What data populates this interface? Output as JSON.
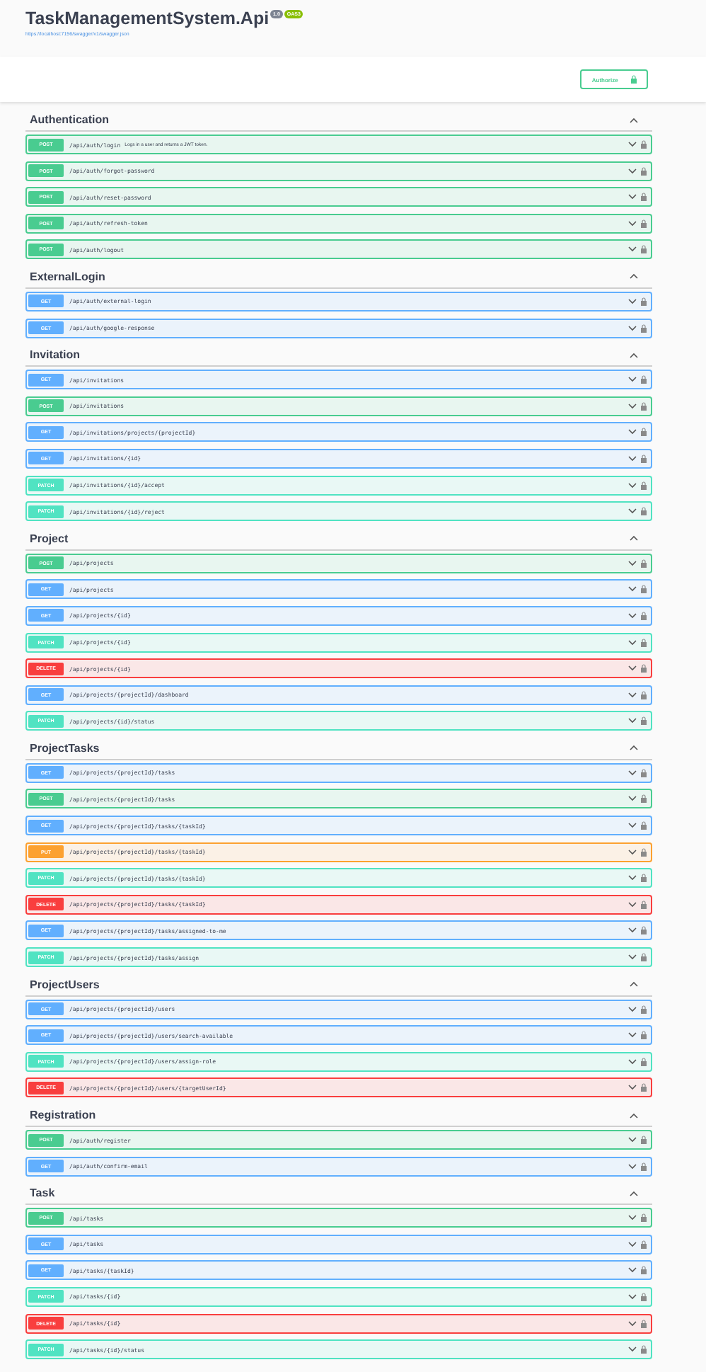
{
  "header": {
    "title": "TaskManagementSystem.Api",
    "version": "1.0",
    "spec": "OAS3",
    "url": "https://localhost:7156/swagger/v1/swagger.json"
  },
  "authorize": {
    "label": "Authorize"
  },
  "sections": [
    {
      "name": "Authentication",
      "expanded": true,
      "operations": [
        {
          "method": "POST",
          "path": "/api/auth/login",
          "summary": "Logs in a user and returns a JWT token."
        },
        {
          "method": "POST",
          "path": "/api/auth/forgot-password"
        },
        {
          "method": "POST",
          "path": "/api/auth/reset-password"
        },
        {
          "method": "POST",
          "path": "/api/auth/refresh-token"
        },
        {
          "method": "POST",
          "path": "/api/auth/logout"
        }
      ]
    },
    {
      "name": "ExternalLogin",
      "expanded": true,
      "operations": [
        {
          "method": "GET",
          "path": "/api/auth/external-login"
        },
        {
          "method": "GET",
          "path": "/api/auth/google-response"
        }
      ]
    },
    {
      "name": "Invitation",
      "expanded": true,
      "operations": [
        {
          "method": "GET",
          "path": "/api/invitations"
        },
        {
          "method": "POST",
          "path": "/api/invitations"
        },
        {
          "method": "GET",
          "path": "/api/invitations/projects/{projectId}"
        },
        {
          "method": "GET",
          "path": "/api/invitations/{id}"
        },
        {
          "method": "PATCH",
          "path": "/api/invitations/{id}/accept"
        },
        {
          "method": "PATCH",
          "path": "/api/invitations/{id}/reject"
        }
      ]
    },
    {
      "name": "Project",
      "expanded": true,
      "operations": [
        {
          "method": "POST",
          "path": "/api/projects"
        },
        {
          "method": "GET",
          "path": "/api/projects"
        },
        {
          "method": "GET",
          "path": "/api/projects/{id}"
        },
        {
          "method": "PATCH",
          "path": "/api/projects/{id}"
        },
        {
          "method": "DELETE",
          "path": "/api/projects/{id}"
        },
        {
          "method": "GET",
          "path": "/api/projects/{projectId}/dashboard"
        },
        {
          "method": "PATCH",
          "path": "/api/projects/{id}/status"
        }
      ]
    },
    {
      "name": "ProjectTasks",
      "expanded": true,
      "operations": [
        {
          "method": "GET",
          "path": "/api/projects/{projectId}/tasks"
        },
        {
          "method": "POST",
          "path": "/api/projects/{projectId}/tasks"
        },
        {
          "method": "GET",
          "path": "/api/projects/{projectId}/tasks/{taskId}"
        },
        {
          "method": "PUT",
          "path": "/api/projects/{projectId}/tasks/{taskId}"
        },
        {
          "method": "PATCH",
          "path": "/api/projects/{projectId}/tasks/{taskId}"
        },
        {
          "method": "DELETE",
          "path": "/api/projects/{projectId}/tasks/{taskId}"
        },
        {
          "method": "GET",
          "path": "/api/projects/{projectId}/tasks/assigned-to-me"
        },
        {
          "method": "PATCH",
          "path": "/api/projects/{projectId}/tasks/assign"
        }
      ]
    },
    {
      "name": "ProjectUsers",
      "expanded": true,
      "operations": [
        {
          "method": "GET",
          "path": "/api/projects/{projectId}/users"
        },
        {
          "method": "GET",
          "path": "/api/projects/{projectId}/users/search-available"
        },
        {
          "method": "PATCH",
          "path": "/api/projects/{projectId}/users/assign-role"
        },
        {
          "method": "DELETE",
          "path": "/api/projects/{projectId}/users/{targetUserId}"
        }
      ]
    },
    {
      "name": "Registration",
      "expanded": true,
      "operations": [
        {
          "method": "POST",
          "path": "/api/auth/register"
        },
        {
          "method": "GET",
          "path": "/api/auth/confirm-email"
        }
      ]
    },
    {
      "name": "Task",
      "expanded": true,
      "operations": [
        {
          "method": "POST",
          "path": "/api/tasks"
        },
        {
          "method": "GET",
          "path": "/api/tasks"
        },
        {
          "method": "GET",
          "path": "/api/tasks/{taskId}"
        },
        {
          "method": "PATCH",
          "path": "/api/tasks/{id}"
        },
        {
          "method": "DELETE",
          "path": "/api/tasks/{id}"
        },
        {
          "method": "PATCH",
          "path": "/api/tasks/{id}/status"
        }
      ]
    }
  ]
}
